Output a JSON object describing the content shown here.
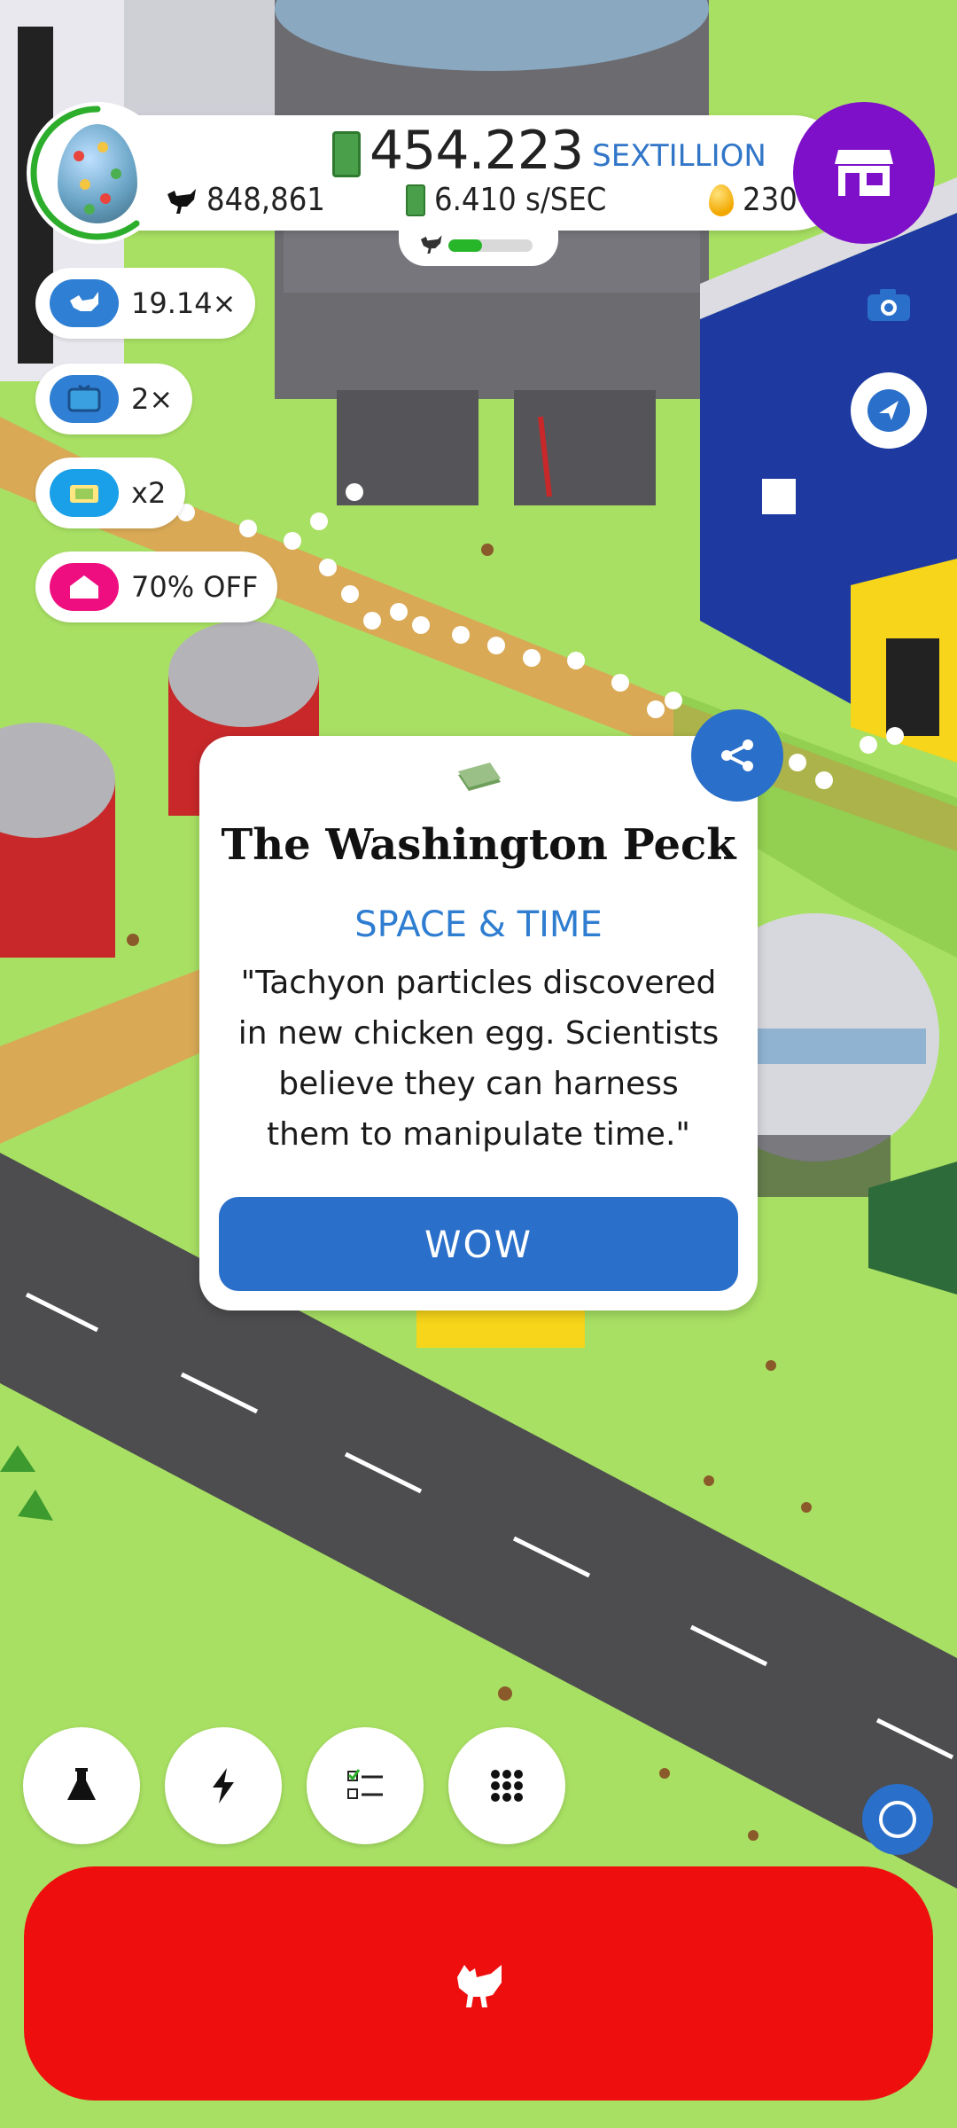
{
  "hud": {
    "money_value": "454.223",
    "money_unit": "SEXTILLION",
    "chicken_count": "848,861",
    "income_rate": "6.410 s/SEC",
    "golden_eggs": "230",
    "hatchery_progress": 0.4
  },
  "boosts": [
    {
      "label": "19.14×",
      "icon": "bird-icon",
      "color": "#2f7fd4"
    },
    {
      "label": "2×",
      "icon": "tv-icon",
      "color": "#2f7fd4"
    },
    {
      "label": "x2",
      "icon": "cash-box-icon",
      "color": "#1aa0e8"
    },
    {
      "label": "70% OFF",
      "icon": "house-icon",
      "color": "#ee0e80"
    }
  ],
  "news": {
    "title": "The Washington Peck",
    "category": "SPACE & TIME",
    "body": "\"Tachyon particles discovered in new chicken egg. Scientists believe they can harness them to manipulate time.\"",
    "button": "WOW"
  },
  "colors": {
    "grass": "#a8e063",
    "accent_blue": "#2a6fc9",
    "shop_purple": "#7d10c8",
    "hatch_red": "#ef0e0e"
  },
  "bottom_bar": [
    "flask-icon",
    "lightning-icon",
    "checklist-icon",
    "grid-icon"
  ]
}
